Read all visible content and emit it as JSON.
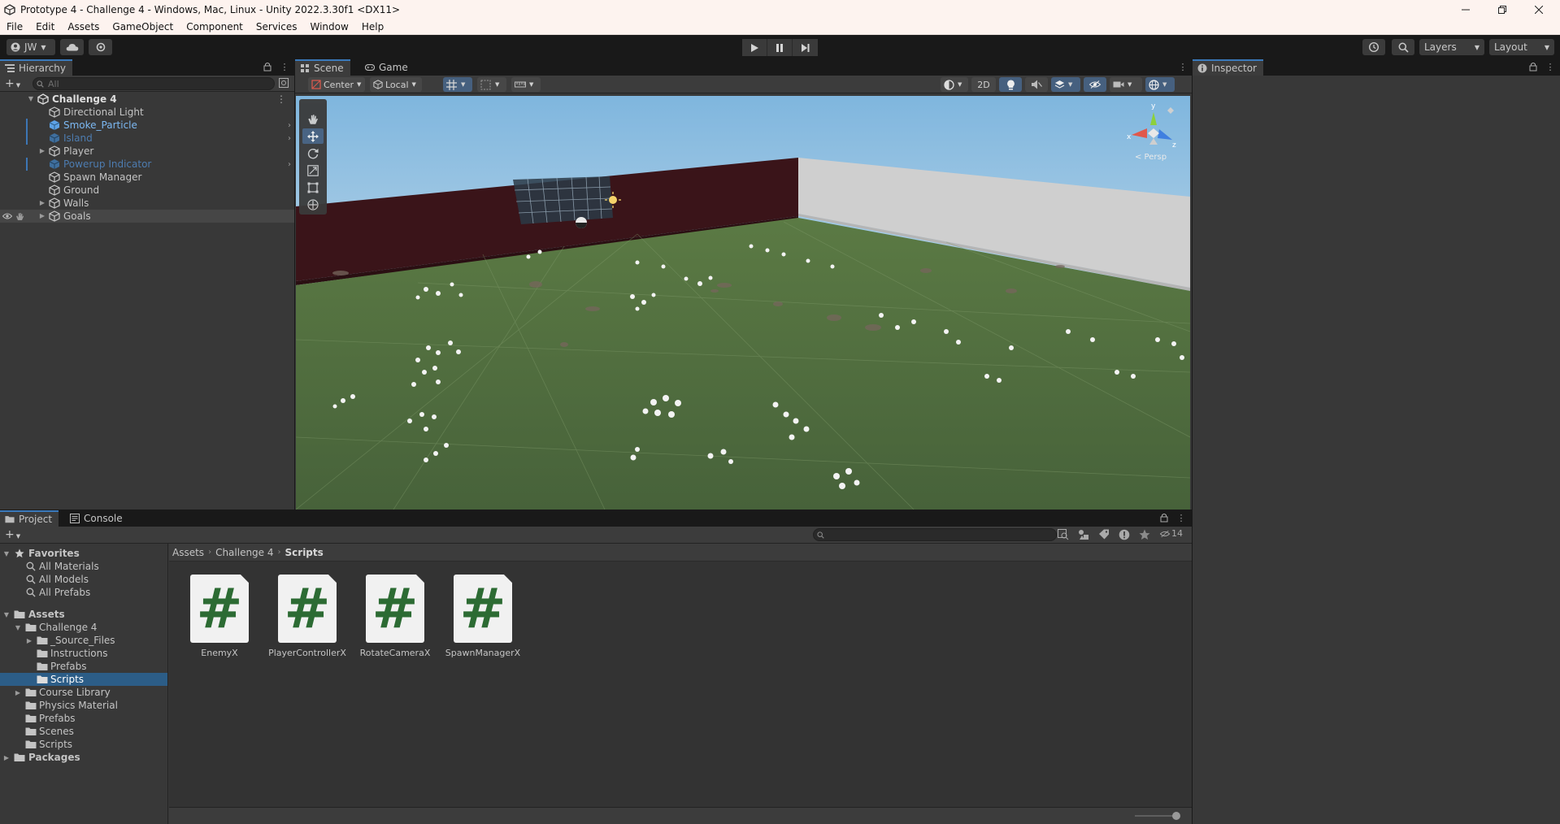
{
  "window": {
    "title": "Prototype 4 - Challenge 4 - Windows, Mac, Linux - Unity 2022.3.30f1 <DX11>",
    "controls": [
      "minimize",
      "maximize",
      "close"
    ]
  },
  "menubar": {
    "items": [
      "File",
      "Edit",
      "Assets",
      "GameObject",
      "Component",
      "Services",
      "Window",
      "Help"
    ]
  },
  "toolbar": {
    "account": "JW",
    "layers_label": "Layers",
    "layout_label": "Layout"
  },
  "hierarchy": {
    "tab_label": "Hierarchy",
    "search_placeholder": "All",
    "scene_name": "Challenge 4",
    "items": [
      {
        "label": "Directional Light",
        "kind": "object"
      },
      {
        "label": "Smoke_Particle",
        "kind": "prefab"
      },
      {
        "label": "Island",
        "kind": "prefab-missing"
      },
      {
        "label": "Player",
        "kind": "object"
      },
      {
        "label": "Powerup Indicator",
        "kind": "prefab-missing"
      },
      {
        "label": "Spawn Manager",
        "kind": "object"
      },
      {
        "label": "Ground",
        "kind": "object"
      },
      {
        "label": "Walls",
        "kind": "object"
      },
      {
        "label": "Goals",
        "kind": "object"
      }
    ]
  },
  "scene": {
    "tabs": [
      "Scene",
      "Game"
    ],
    "pivot_mode": "Center",
    "pivot_rotation": "Local",
    "mode_2d": "2D",
    "persp_label": "< Persp",
    "gizmo_axes": {
      "y": "y",
      "x": "x",
      "z": "z"
    }
  },
  "inspector": {
    "tab_label": "Inspector"
  },
  "project": {
    "tabs": [
      "Project",
      "Console"
    ],
    "favorites_label": "Favorites",
    "favorites": [
      "All Materials",
      "All Models",
      "All Prefabs"
    ],
    "assets_label": "Assets",
    "challenge_folder": "Challenge 4",
    "challenge_children": [
      "_Source_Files",
      "Instructions",
      "Prefabs",
      "Scripts"
    ],
    "asset_folders": [
      "Course Library",
      "Physics Material",
      "Prefabs",
      "Scenes",
      "Scripts"
    ],
    "packages_label": "Packages",
    "breadcrumb": [
      "Assets",
      "Challenge 4",
      "Scripts"
    ],
    "hidden_count": "14",
    "scripts": [
      "EnemyX",
      "PlayerControllerX",
      "RotateCameraX",
      "SpawnManagerX"
    ],
    "script_glyph": "#"
  },
  "colors": {
    "accent": "#3a79bb",
    "selection": "#2c5d87",
    "prefab_text": "#7cb8f2",
    "ground": "#4e6b3a",
    "wall_dark": "#3a1419"
  }
}
